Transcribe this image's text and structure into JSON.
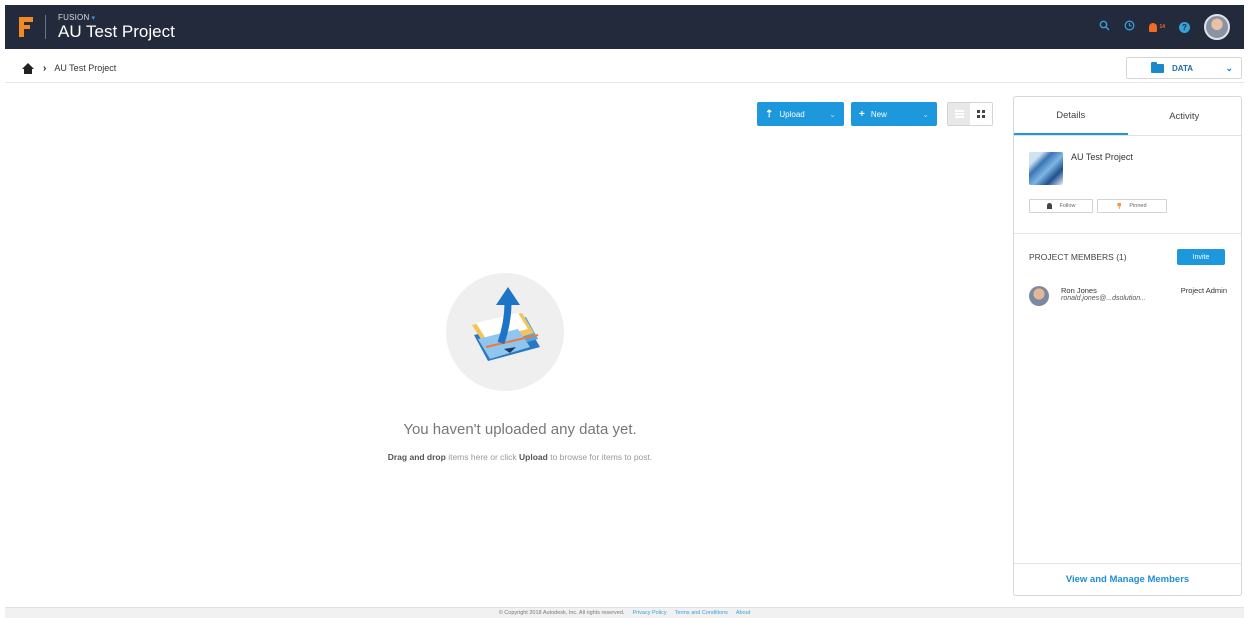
{
  "header": {
    "app_name": "FUSION",
    "project_title": "AU Test Project",
    "notification_count": "14"
  },
  "breadcrumb": {
    "current": "AU Test Project"
  },
  "data_dropdown": {
    "label": "DATA"
  },
  "toolbar": {
    "upload_label": "Upload",
    "new_label": "New"
  },
  "empty_state": {
    "title": "You haven't uploaded any data yet.",
    "sub_bold_1": "Drag and drop",
    "sub_text_1": " items here or click ",
    "sub_bold_2": "Upload",
    "sub_text_2": " to browse for items to post."
  },
  "panel": {
    "tabs": [
      {
        "label": "Details",
        "active": true
      },
      {
        "label": "Activity",
        "active": false
      }
    ],
    "project_name": "AU Test Project",
    "follow_label": "Follow",
    "pinned_label": "Pinned",
    "members_title": "PROJECT MEMBERS (1)",
    "invite_label": "Invite",
    "members": [
      {
        "name": "Ron Jones",
        "email": "ronald.jones@...dsolution...",
        "role": "Project Admin"
      }
    ],
    "view_manage_label": "View and Manage Members"
  },
  "footer": {
    "copyright": "© Copyright 2018 Autodesk, Inc. All rights reserved.",
    "links": [
      "Privacy Policy",
      "Terms and Conditions",
      "About"
    ]
  },
  "colors": {
    "topbar": "#232a3b",
    "accent": "#1d98dc",
    "logo": "#f08a24",
    "notification": "#f26b22"
  },
  "icons": [
    "fusion-logo-icon",
    "search-icon",
    "clock-icon",
    "bell-icon",
    "help-icon",
    "home-icon",
    "folder-icon",
    "upload-icon",
    "plus-icon",
    "list-view-icon",
    "grid-view-icon"
  ]
}
